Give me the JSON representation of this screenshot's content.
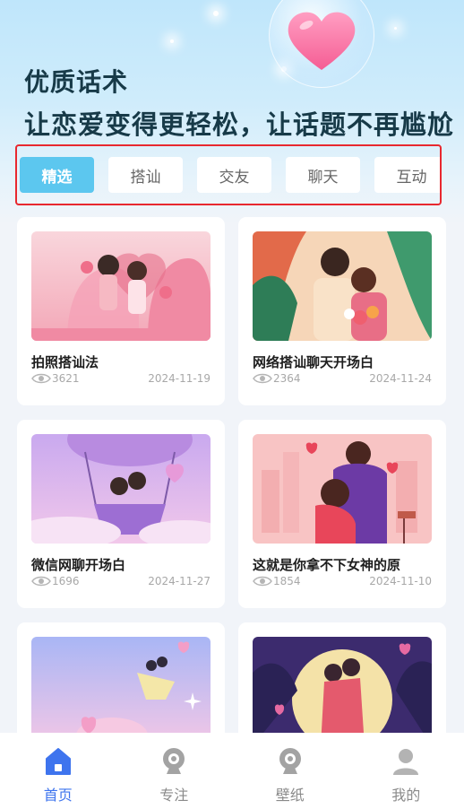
{
  "hero": {
    "line1": "优质话术",
    "line2": "让恋爱变得更轻松，让话题不再尴尬"
  },
  "categories": {
    "items": [
      {
        "label": "精选",
        "active": true
      },
      {
        "label": "搭讪",
        "active": false
      },
      {
        "label": "交友",
        "active": false
      },
      {
        "label": "聊天",
        "active": false
      },
      {
        "label": "互动",
        "active": false
      }
    ]
  },
  "articles": [
    {
      "title": "拍照搭讪法",
      "views": "3621",
      "date": "2024-11-19",
      "image": "couple-photo-pink-heart-arch"
    },
    {
      "title": "网络搭讪聊天开场白",
      "views": "2364",
      "date": "2024-11-24",
      "image": "couple-flowers-bouquet"
    },
    {
      "title": "微信网聊开场白",
      "views": "1696",
      "date": "2024-11-27",
      "image": "couple-hot-air-balloon"
    },
    {
      "title": "这就是你拿不下女神的原",
      "views": "1854",
      "date": "2024-11-10",
      "image": "couple-hug-city-hearts"
    },
    {
      "title": "",
      "views": "",
      "date": "",
      "image": "couple-dancing-clouds"
    },
    {
      "title": "",
      "views": "",
      "date": "",
      "image": "couple-embrace-full-moon"
    }
  ],
  "tabbar": {
    "items": [
      {
        "label": "首页",
        "icon": "home-icon",
        "active": true
      },
      {
        "label": "专注",
        "icon": "camera-icon",
        "active": false
      },
      {
        "label": "壁纸",
        "icon": "camera-icon",
        "active": false
      },
      {
        "label": "我的",
        "icon": "user-icon",
        "active": false
      }
    ]
  },
  "colors": {
    "accent": "#5cc7ef",
    "tabbar_active": "#3e74ee",
    "highlight_border": "#e8282f",
    "headline": "#173a48"
  }
}
